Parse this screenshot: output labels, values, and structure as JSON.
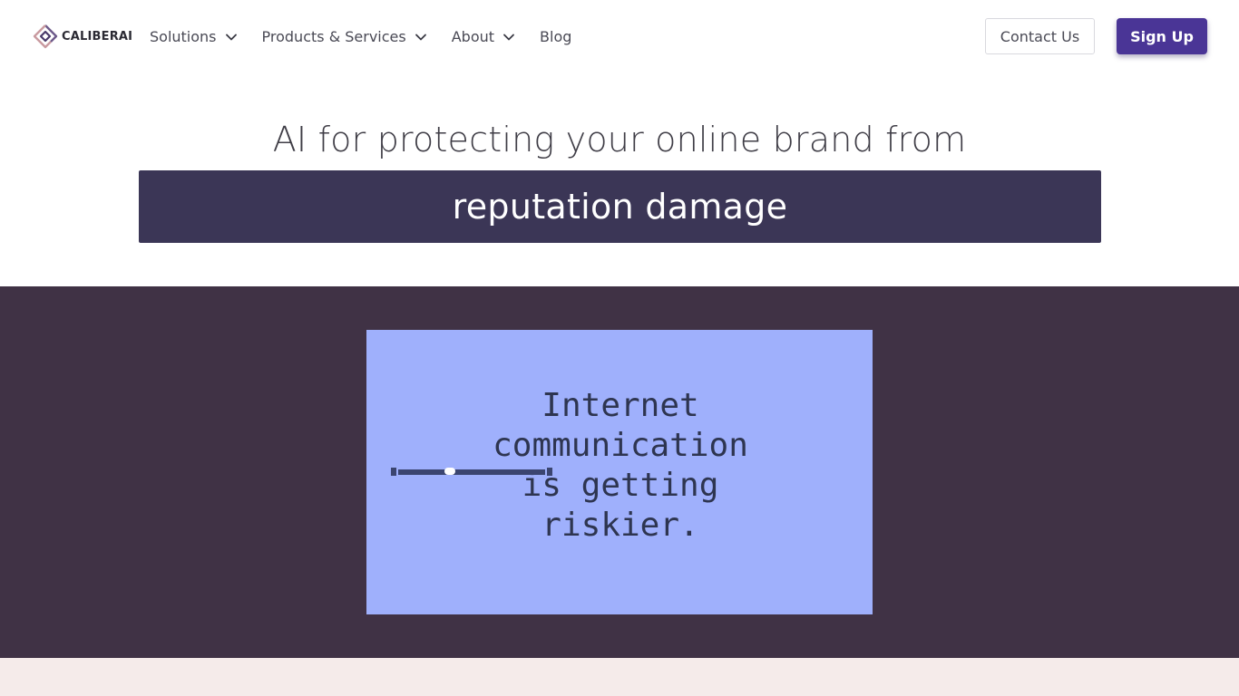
{
  "header": {
    "logo_text": "CALIBERAI",
    "logo_icon": "caliberai-logo-icon",
    "nav": [
      {
        "label": "Solutions",
        "has_dropdown": true
      },
      {
        "label": "Products & Services",
        "has_dropdown": true
      },
      {
        "label": "About",
        "has_dropdown": true
      },
      {
        "label": "Blog",
        "has_dropdown": false
      }
    ],
    "contact_label": "Contact Us",
    "signup_label": "Sign Up"
  },
  "hero": {
    "line1": "AI for protecting your online brand from",
    "line2": "reputation damage"
  },
  "video": {
    "text": "Internet\ncommunication\nis getting\nriskier.",
    "progress": 0.35
  },
  "colors": {
    "brand_purple": "#4a3596",
    "hero_box": "#3b3656",
    "video_section_bg": "#403245",
    "video_bg": "#9fb0fc",
    "bottom_band": "#f5ebea"
  }
}
